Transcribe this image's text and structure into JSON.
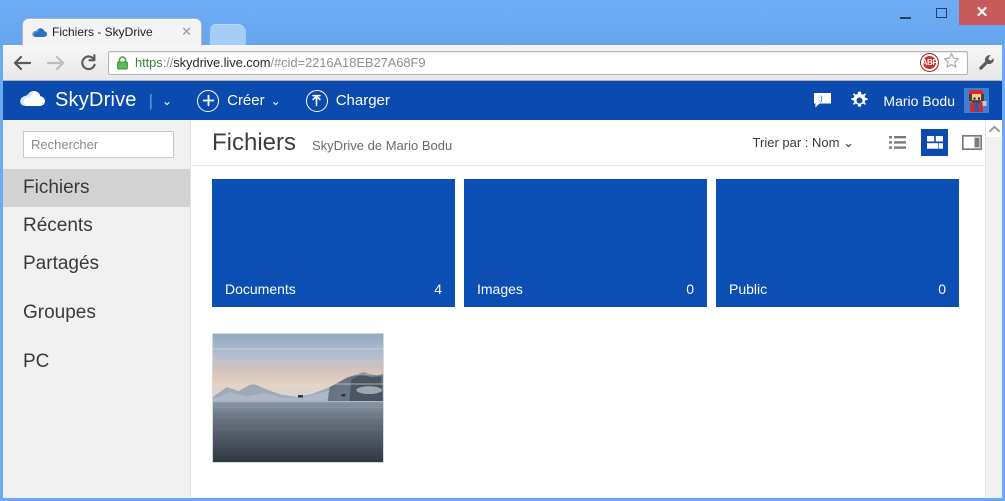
{
  "window": {
    "minimize_label": "Minimize",
    "maximize_label": "Maximize",
    "close_label": "✕"
  },
  "browser": {
    "tab": {
      "title": "Fichiers - SkyDrive",
      "close_label": "✕",
      "favicon": "skydrive-cloud-icon"
    },
    "newtab_label": "",
    "back_label": "←",
    "forward_label": "→",
    "reload_label": "⟳",
    "url": {
      "scheme": "https",
      "separator": "://",
      "host": "skydrive.live.com",
      "path": "/#cid=2216A18EB27A68F9",
      "full": "https://skydrive.live.com/#cid=2216A18EB27A68F9"
    },
    "lock_icon": "secure-lock-icon",
    "extension_abp_label": "ABP",
    "bookmark_icon": "star-icon",
    "menu_icon": "wrench-icon"
  },
  "header": {
    "brand": "SkyDrive",
    "brand_chevron": "⌄",
    "create": {
      "label": "Créer",
      "icon": "plus-circle-icon",
      "chevron": "⌄"
    },
    "upload": {
      "label": "Charger",
      "icon": "upload-circle-icon"
    },
    "messaging_icon": "messaging-icon",
    "settings_icon": "gear-icon",
    "user_name": "Mario Bodu",
    "avatar": "mario-avatar"
  },
  "sidebar": {
    "search_placeholder": "Rechercher",
    "search_value": "",
    "search_icon": "search-icon",
    "items": [
      {
        "label": "Fichiers",
        "active": true
      },
      {
        "label": "Récents",
        "active": false
      },
      {
        "label": "Partagés",
        "active": false
      },
      {
        "label": "Groupes",
        "active": false
      },
      {
        "label": "PC",
        "active": false
      }
    ]
  },
  "content": {
    "title": "Fichiers",
    "subtitle": "SkyDrive de Mario Bodu",
    "sort_label": "Trier par : Nom",
    "sort_chevron": "⌄",
    "views": [
      {
        "name": "list-view",
        "selected": false
      },
      {
        "name": "tiles-view",
        "selected": true
      },
      {
        "name": "details-pane-view",
        "selected": false
      }
    ],
    "tiles": [
      {
        "name": "Documents",
        "count": "4",
        "color": "#0c4fb4"
      },
      {
        "name": "Images",
        "count": "0",
        "color": "#0c4fb4"
      },
      {
        "name": "Public",
        "count": "0",
        "color": "#0c4fb4"
      }
    ],
    "photo": {
      "name": "fjord-sunset-photo",
      "alt": "Photo de fjord au crépuscule"
    }
  },
  "colors": {
    "window_frame": "#6aaaf2",
    "header_blue": "#0b4bb0",
    "tile_blue": "#0c4fb4",
    "sidebar_bg": "#f1f1f1",
    "sidebar_active": "#d2d2d2",
    "close_button": "#c75b5b"
  }
}
